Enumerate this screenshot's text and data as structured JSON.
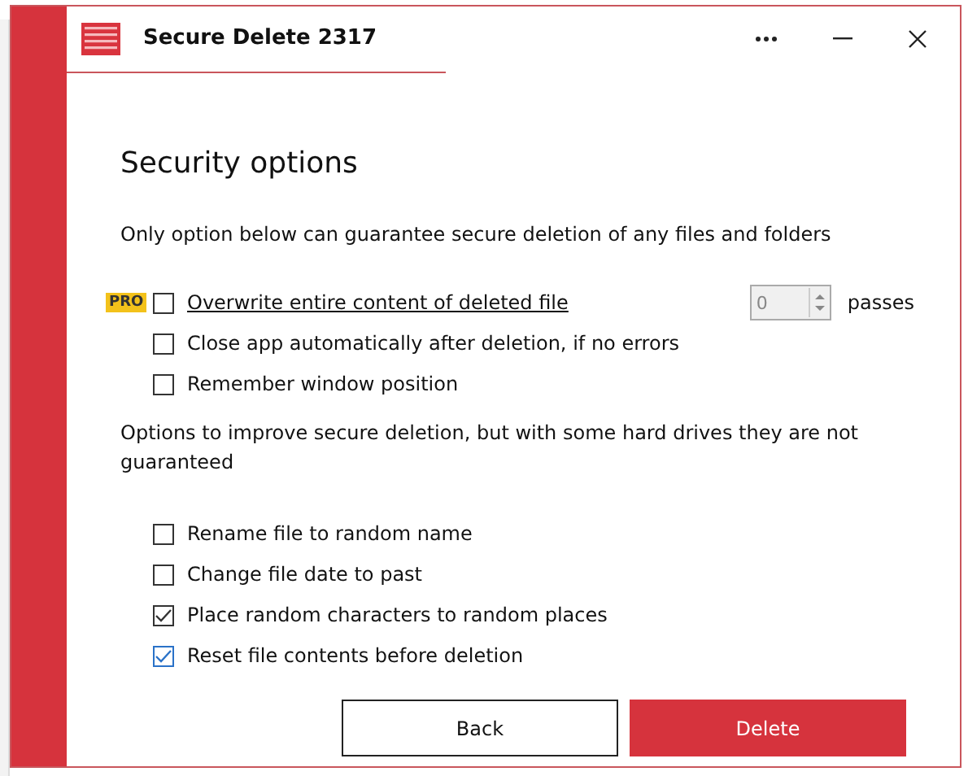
{
  "window": {
    "title": "Secure Delete 2317"
  },
  "heading": "Security options",
  "intro": "Only option below can guarantee secure deletion of any files and folders",
  "primary_options": [
    {
      "label": "Overwrite entire content of deleted file",
      "checked": false,
      "pro_badge": "PRO",
      "underlined": true,
      "spinner": {
        "value": "0",
        "disabled": true
      },
      "unit": "passes"
    },
    {
      "label": "Close app automatically after deletion, if no errors",
      "checked": false
    },
    {
      "label": "Remember window position",
      "checked": false
    }
  ],
  "secondary_intro": "Options to improve secure deletion, but with some hard drives they are not guaranteed",
  "secondary_options": [
    {
      "label": "Rename file to random name",
      "checked": false
    },
    {
      "label": "Change file date to past",
      "checked": false
    },
    {
      "label": "Place random characters to random places",
      "checked": true
    },
    {
      "label": "Reset file contents before deletion",
      "checked": true
    }
  ],
  "buttons": [
    {
      "label": "Back",
      "kind": "secondary"
    },
    {
      "label": "Delete",
      "kind": "primary"
    }
  ]
}
